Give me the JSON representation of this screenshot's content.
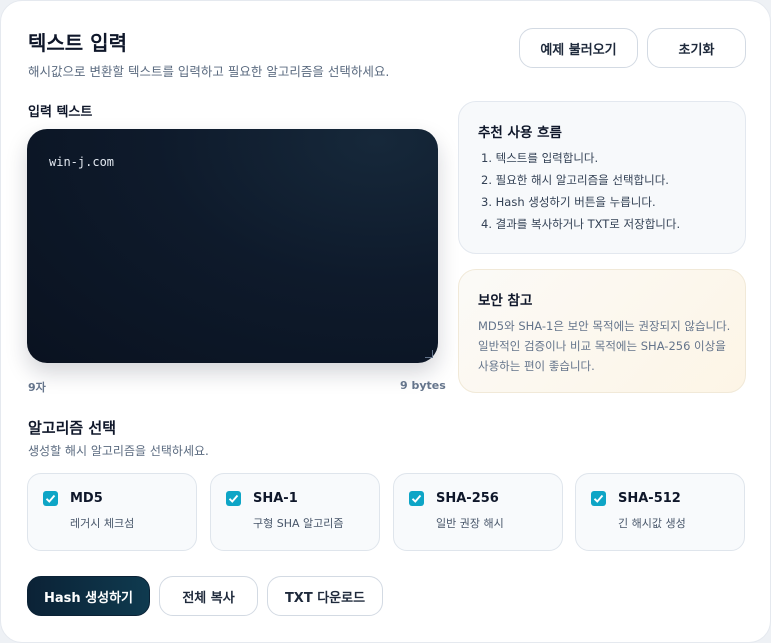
{
  "header": {
    "title": "텍스트 입력",
    "subtitle": "해시값으로 변환할 텍스트를 입력하고 필요한 알고리즘을 선택하세요.",
    "load_example_label": "예제 불러오기",
    "reset_label": "초기화"
  },
  "input": {
    "label": "입력 텍스트",
    "value": "win-j.com",
    "char_count": "9자",
    "byte_count": "9 bytes"
  },
  "flow_panel": {
    "title": "추천 사용 흐름",
    "steps": [
      "1. 텍스트를 입력합니다.",
      "2. 필요한 해시 알고리즘을 선택합니다.",
      "3. Hash 생성하기 버튼을 누릅니다.",
      "4. 결과를 복사하거나 TXT로 저장합니다."
    ]
  },
  "security_panel": {
    "title": "보안 참고",
    "text": "MD5와 SHA-1은 보안 목적에는 권장되지 않습니다. 일반적인 검증이나 비교 목적에는 SHA-256 이상을 사용하는 편이 좋습니다."
  },
  "algorithms": {
    "title": "알고리즘 선택",
    "subtitle": "생성할 해시 알고리즘을 선택하세요.",
    "items": [
      {
        "name": "MD5",
        "desc": "레거시 체크섬",
        "checked": true
      },
      {
        "name": "SHA-1",
        "desc": "구형 SHA 알고리즘",
        "checked": true
      },
      {
        "name": "SHA-256",
        "desc": "일반 권장 해시",
        "checked": true
      },
      {
        "name": "SHA-512",
        "desc": "긴 해시값 생성",
        "checked": true
      }
    ]
  },
  "actions": {
    "generate_label": "Hash 생성하기",
    "copy_all_label": "전체 복사",
    "download_label": "TXT 다운로드"
  },
  "colors": {
    "accent": "#0ea5c6",
    "primary_button": "#0b2236",
    "textarea_bg": "#0e1a2b",
    "warning_panel_bg": "#fdf8ee"
  },
  "icons": {
    "checkbox": "check-icon"
  }
}
